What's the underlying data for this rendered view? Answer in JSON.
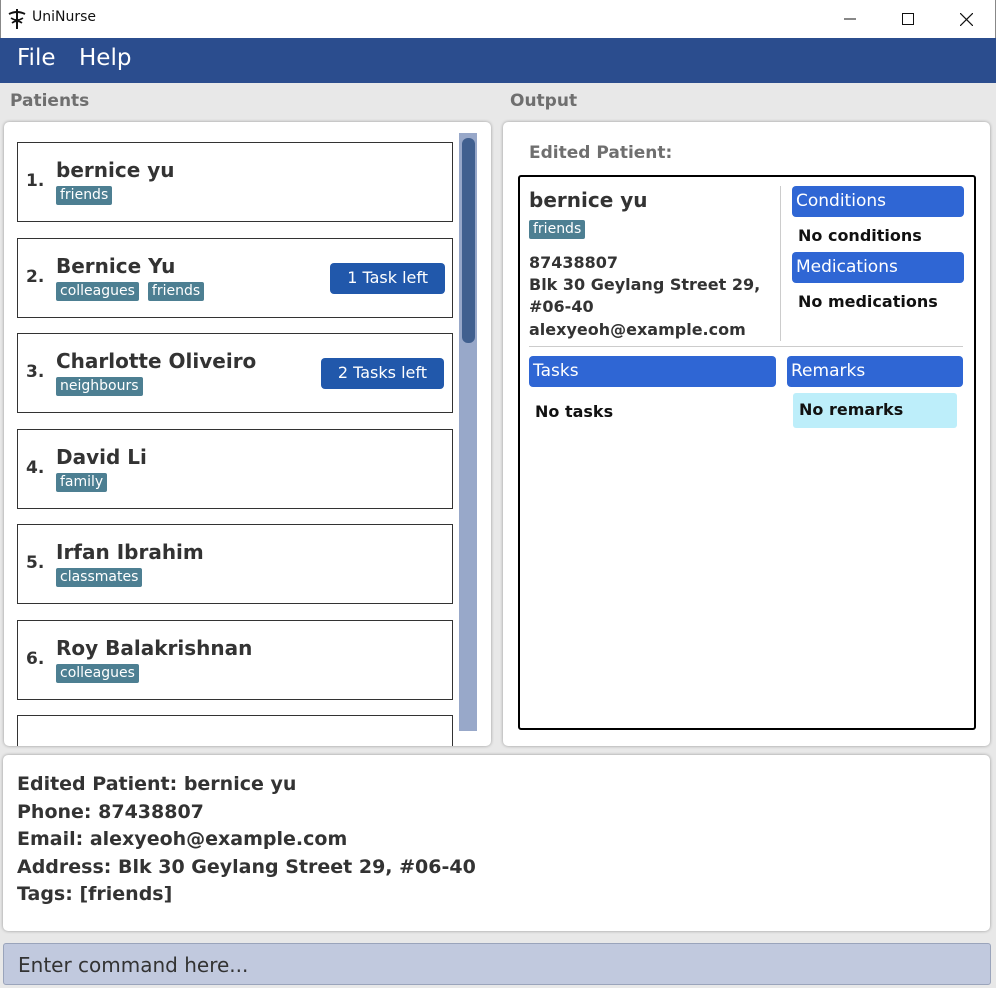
{
  "window": {
    "title": "UniNurse"
  },
  "menu": {
    "file": "File",
    "help": "Help"
  },
  "labels": {
    "patients": "Patients",
    "output": "Output"
  },
  "patients": [
    {
      "index": "1.",
      "name": "bernice yu",
      "tags": [
        "friends"
      ],
      "tasks": ""
    },
    {
      "index": "2.",
      "name": "Bernice Yu",
      "tags": [
        "colleagues",
        "friends"
      ],
      "tasks": "1 Task left"
    },
    {
      "index": "3.",
      "name": "Charlotte Oliveiro",
      "tags": [
        "neighbours"
      ],
      "tasks": "2 Tasks left"
    },
    {
      "index": "4.",
      "name": "David Li",
      "tags": [
        "family"
      ],
      "tasks": ""
    },
    {
      "index": "5.",
      "name": "Irfan Ibrahim",
      "tags": [
        "classmates"
      ],
      "tasks": ""
    },
    {
      "index": "6.",
      "name": "Roy Balakrishnan",
      "tags": [
        "colleagues"
      ],
      "tasks": ""
    }
  ],
  "output": {
    "heading": "Edited Patient:",
    "name": "bernice yu",
    "tag": "friends",
    "phone": "87438807",
    "address_line1": "Blk 30 Geylang Street 29,",
    "address_line2": "#06-40",
    "email": "alexyeoh@example.com",
    "conditions_header": "Conditions",
    "conditions_value": "No conditions",
    "medications_header": "Medications",
    "medications_value": "No medications",
    "tasks_header": "Tasks",
    "tasks_value": "No tasks",
    "remarks_header": "Remarks",
    "remarks_value": "No remarks"
  },
  "result": {
    "line1": "Edited Patient: bernice yu",
    "line2": "Phone: 87438807",
    "line3": "Email: alexyeoh@example.com",
    "line4": "Address: Blk 30 Geylang Street 29, #06-40",
    "line5": "Tags: [friends]"
  },
  "command": {
    "placeholder": "Enter command here..."
  },
  "colors": {
    "menu_bar": "#2b4d8e",
    "tag": "#4d7f92",
    "task_button": "#2158ab",
    "section_header": "#2f66d4",
    "remarks_bg": "#bdeefa"
  }
}
